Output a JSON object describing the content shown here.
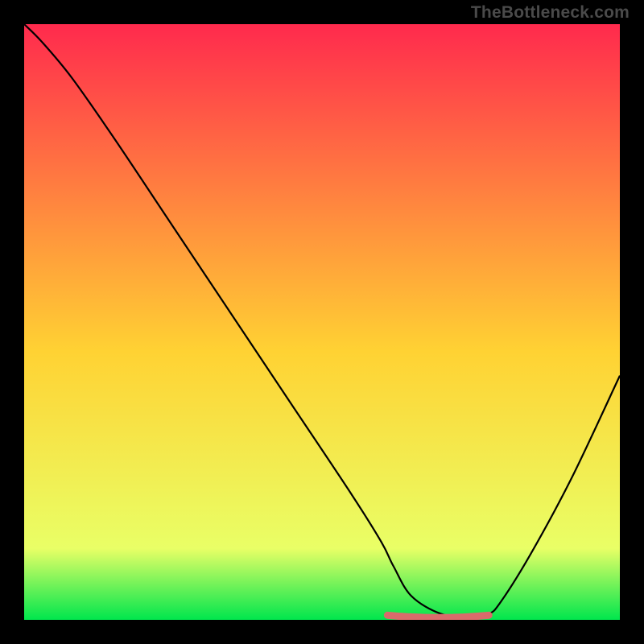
{
  "watermark": "TheBottleneck.com",
  "chart_data": {
    "type": "line",
    "title": "",
    "xlabel": "",
    "ylabel": "",
    "xlim": [
      0,
      100
    ],
    "ylim": [
      0,
      100
    ],
    "background_gradient": {
      "top": "#ff2a4d",
      "mid": "#ffd233",
      "bottom": "#00e64d"
    },
    "series": [
      {
        "name": "curve",
        "color": "#000000",
        "x": [
          0,
          3,
          8,
          15,
          25,
          35,
          45,
          55,
          60,
          62,
          65,
          70,
          75,
          78,
          80,
          85,
          92,
          100
        ],
        "y": [
          100,
          97,
          91,
          81,
          66,
          51,
          36,
          21,
          13,
          9,
          4,
          1,
          0.5,
          1,
          3,
          11,
          24,
          41
        ]
      }
    ],
    "highlight": {
      "color": "#d96b6b",
      "x_start": 61,
      "x_end": 78,
      "y": 0.5
    }
  }
}
